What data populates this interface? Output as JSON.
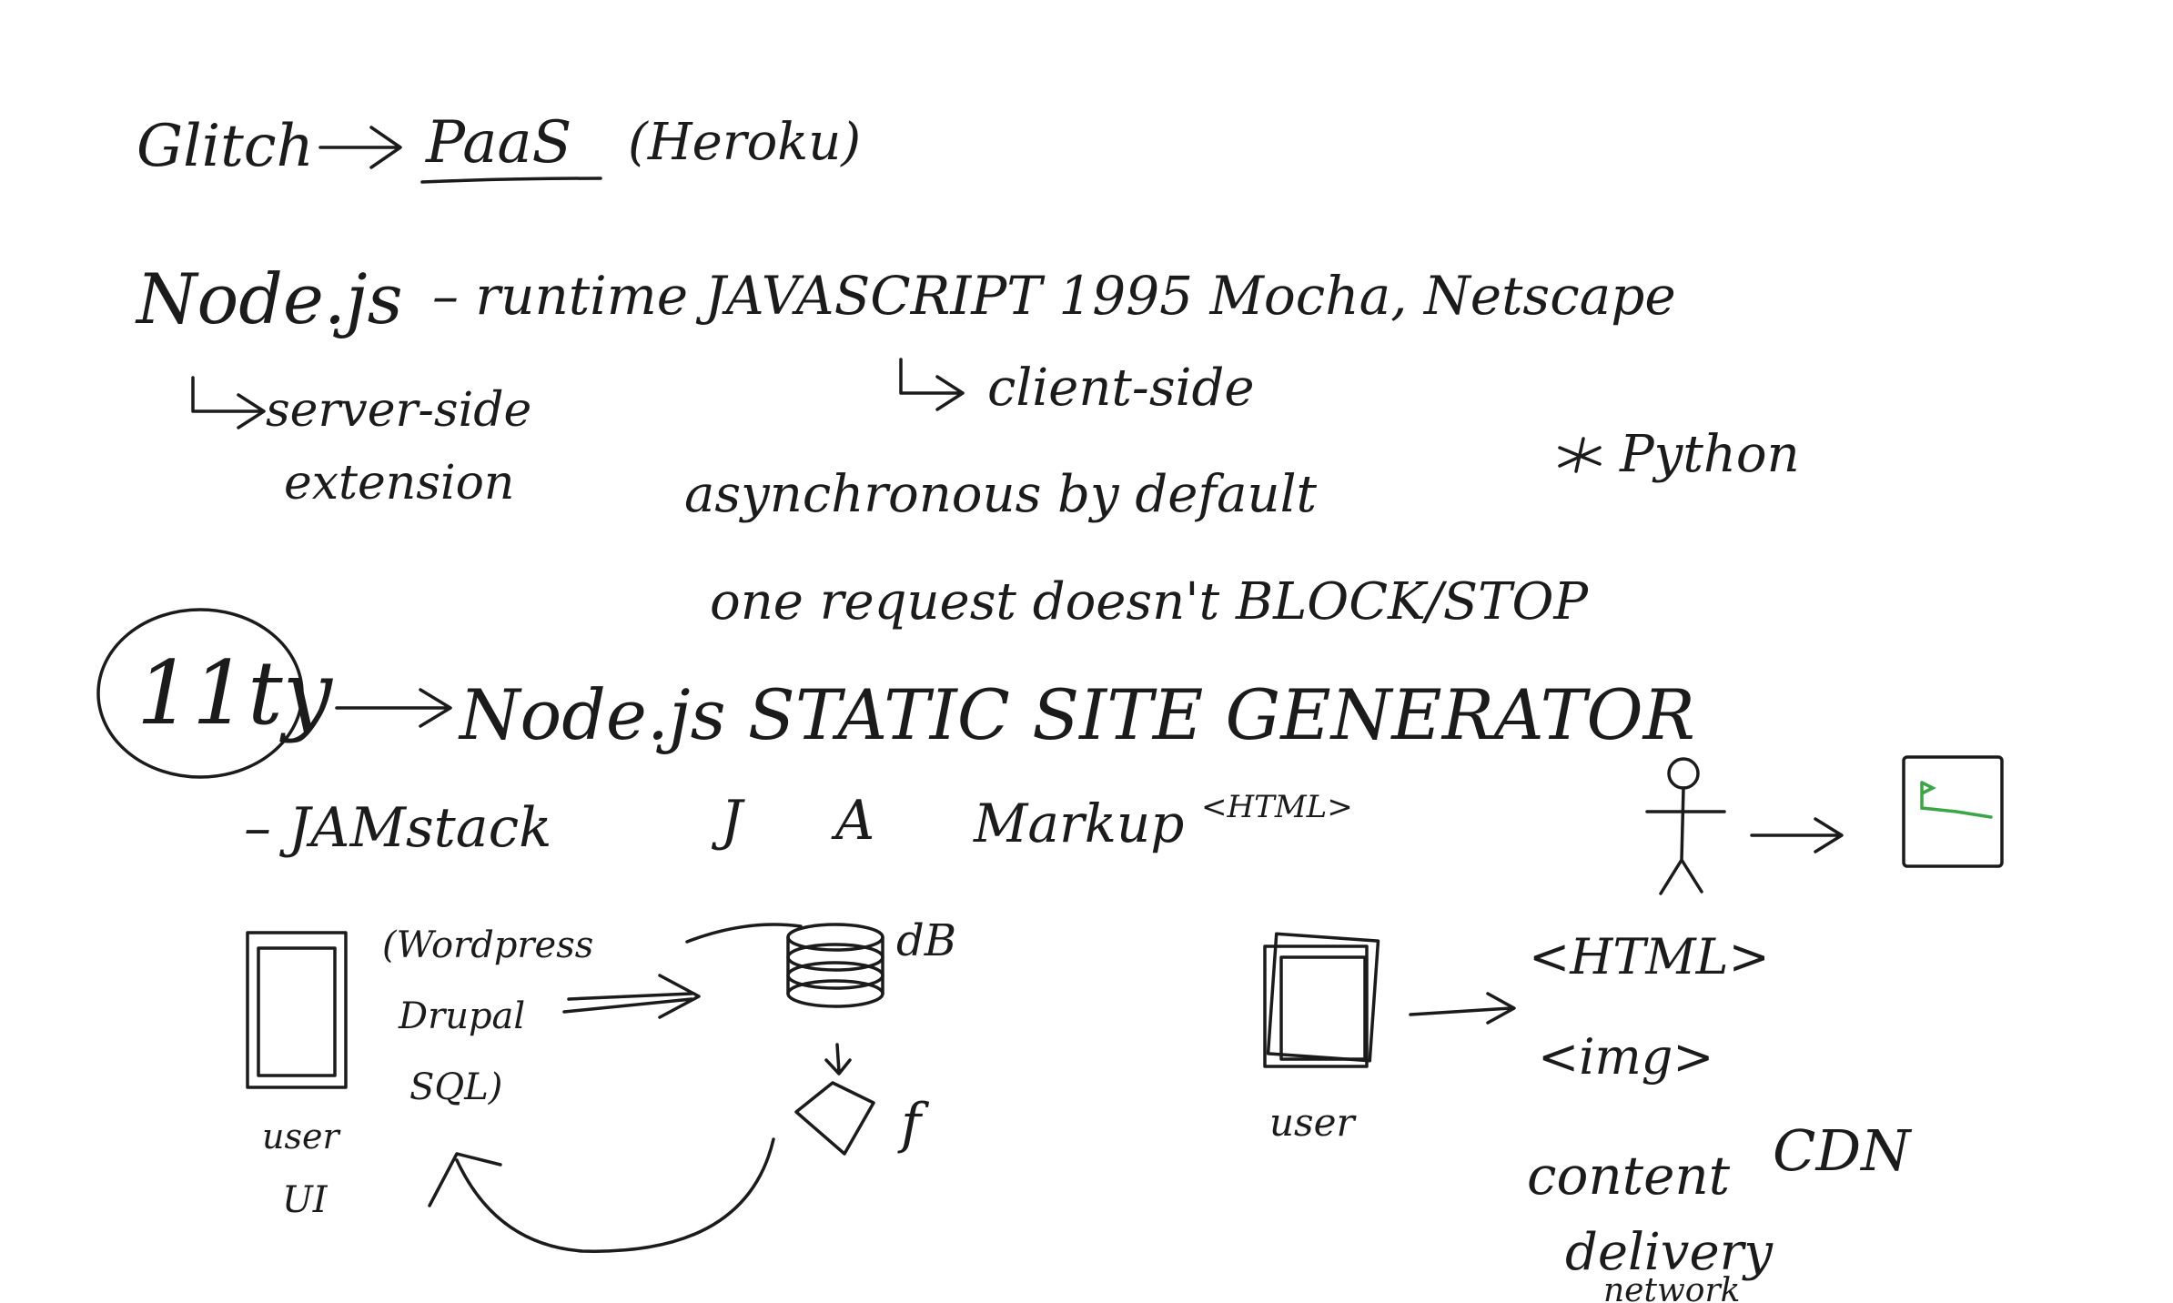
{
  "canvas": {
    "background": "#ffffff",
    "ink_color": "#1b1b1b",
    "accent_color": "#3aa645"
  },
  "notes": {
    "glitch": "Glitch",
    "paas": "PaaS",
    "heroku": "(Heroku)",
    "nodejs": "Node.js",
    "runtime": "– runtime JAVASCRIPT 1995 Mocha, Netscape",
    "server_side": "server-side",
    "extension": "extension",
    "client_side": "client-side",
    "python": "Python",
    "asynchronous": "asynchronous by default",
    "one_request": "one request doesn't BLOCK/STOP",
    "eleventy": "11ty",
    "ssg": "Node.js STATIC SITE GENERATOR",
    "jamstack": "– JAMstack",
    "jam_j": "J",
    "jam_a": "A",
    "jam_markup": "Markup",
    "jam_html": "<HTML>",
    "wordpress": "(Wordpress",
    "drupal": "Drupal",
    "sql": "SQL)",
    "db": "dB",
    "f": "f",
    "user_ui_1": "user",
    "user_ui_2": "UI",
    "user_right": "user",
    "html_tag": "<HTML>",
    "img_tag": "<img>",
    "content": "content",
    "cdn": "CDN",
    "delivery": "delivery",
    "network": "network"
  }
}
